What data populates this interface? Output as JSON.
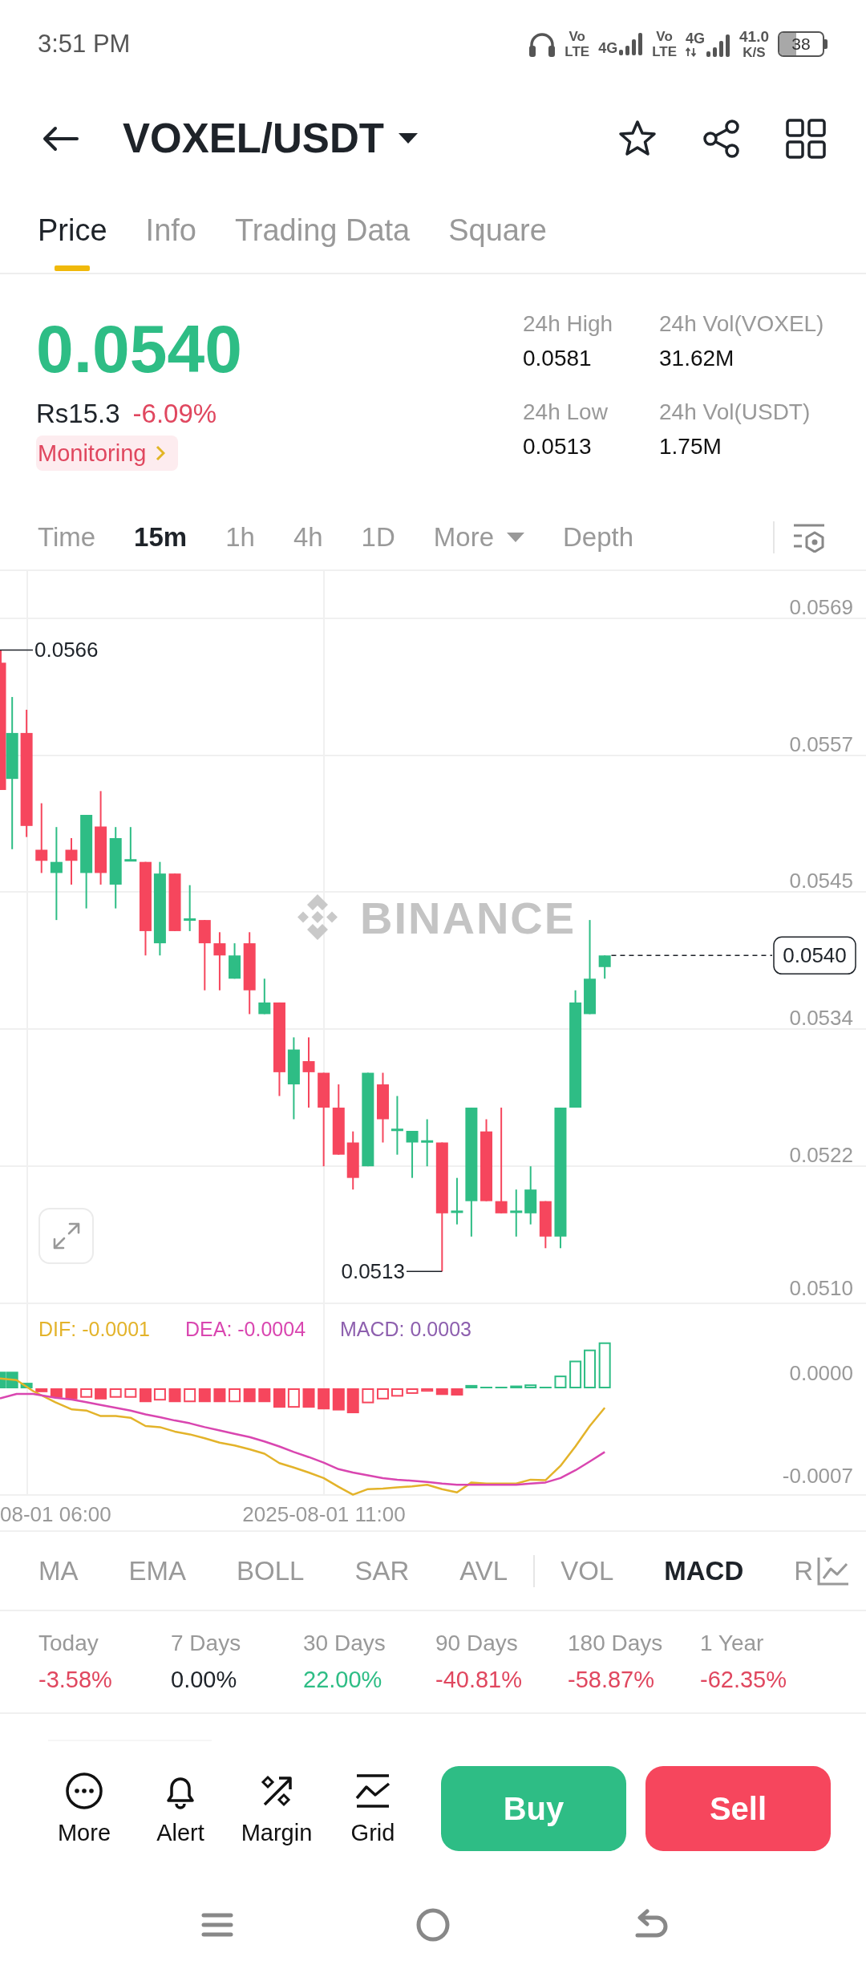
{
  "status_bar": {
    "time": "3:51 PM",
    "sims": [
      {
        "top": "Vo",
        "bottom": "LTE",
        "network": "4G",
        "activity": false
      },
      {
        "top": "Vo",
        "bottom": "LTE",
        "network": "4G",
        "activity": true
      }
    ],
    "speed": "41.0",
    "speed_unit": "K/S",
    "battery": "38"
  },
  "header": {
    "pair": "VOXEL/USDT"
  },
  "tabs": [
    {
      "label": "Price",
      "selected": true
    },
    {
      "label": "Info",
      "selected": false
    },
    {
      "label": "Trading Data",
      "selected": false
    },
    {
      "label": "Square",
      "selected": false
    }
  ],
  "ticker": {
    "price": "0.0540",
    "price_up": true,
    "local_price": "Rs15.3",
    "change": "-6.09%",
    "change_up": false,
    "monitoring": "Monitoring",
    "stats": [
      {
        "label": "24h High",
        "value": "0.0581"
      },
      {
        "label": "24h Vol(VOXEL)",
        "value": "31.62M"
      },
      {
        "label": "24h Low",
        "value": "0.0513"
      },
      {
        "label": "24h Vol(USDT)",
        "value": "1.75M"
      }
    ]
  },
  "intervals": [
    {
      "kind": "tab",
      "label": "Time",
      "selected": false
    },
    {
      "kind": "tab",
      "label": "15m",
      "selected": true
    },
    {
      "kind": "tab",
      "label": "1h",
      "selected": false
    },
    {
      "kind": "tab",
      "label": "4h",
      "selected": false
    },
    {
      "kind": "tab",
      "label": "1D",
      "selected": false
    },
    {
      "kind": "dropdown",
      "label": "More",
      "selected": false
    },
    {
      "kind": "tab",
      "label": "Depth",
      "selected": false
    }
  ],
  "chart": {
    "price_axis": [
      "0.0569",
      "0.0557",
      "0.0545",
      "0.0534",
      "0.0522",
      "0.0510"
    ],
    "high_marker": "0.0566",
    "low_marker": "0.0513",
    "last_price": "0.0540",
    "watermark": "BINANCE"
  },
  "macd": {
    "legend": [
      {
        "kind": "dif",
        "text": "DIF: -0.0001",
        "color": "#e3b32a"
      },
      {
        "kind": "dea",
        "text": "DEA: -0.0004",
        "color": "#d946b0"
      },
      {
        "kind": "macd",
        "text": "MACD: 0.0003",
        "color": "#8d5fae"
      }
    ],
    "axis": [
      "0.0000",
      "-0.0007"
    ]
  },
  "time_axis": [
    "08-01 06:00",
    "2025-08-01 11:00"
  ],
  "indicators": {
    "main": [
      {
        "label": "MA",
        "selected": false
      },
      {
        "label": "EMA",
        "selected": false
      },
      {
        "label": "BOLL",
        "selected": false
      },
      {
        "label": "SAR",
        "selected": false
      },
      {
        "label": "AVL",
        "selected": false
      }
    ],
    "sub": [
      {
        "label": "VOL",
        "selected": false
      },
      {
        "label": "MACD",
        "selected": true
      },
      {
        "label": "R",
        "selected": false
      }
    ]
  },
  "performance": [
    {
      "period": "Today",
      "change": "-3.58%",
      "color": "#e0475f"
    },
    {
      "period": "7 Days",
      "change": "0.00%",
      "color": "#1e2329"
    },
    {
      "period": "30 Days",
      "change": "22.00%",
      "color": "#2ebd85"
    },
    {
      "period": "90 Days",
      "change": "-40.81%",
      "color": "#e0475f"
    },
    {
      "period": "180 Days",
      "change": "-58.87%",
      "color": "#e0475f"
    },
    {
      "period": "1 Year",
      "change": "-62.35%",
      "color": "#e0475f"
    }
  ],
  "actions": [
    {
      "kind": "more",
      "label": "More"
    },
    {
      "kind": "alert",
      "label": "Alert"
    },
    {
      "kind": "margin",
      "label": "Margin"
    },
    {
      "kind": "grid",
      "label": "Grid"
    }
  ],
  "trade_buttons": [
    {
      "kind": "buy",
      "label": "Buy"
    },
    {
      "kind": "sell",
      "label": "Sell"
    }
  ]
}
